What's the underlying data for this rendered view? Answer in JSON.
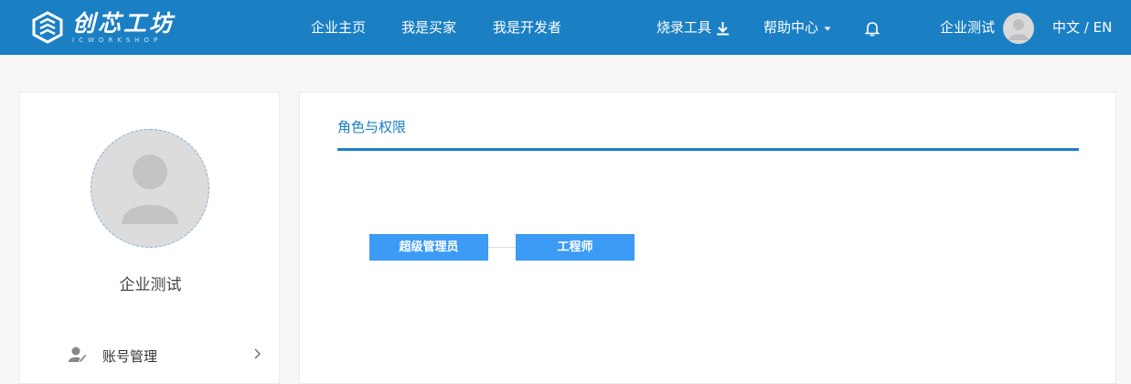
{
  "header": {
    "logo_cn": "创芯工坊",
    "logo_en": "ICWORKSHOP",
    "nav": {
      "home": "企业主页",
      "buyer": "我是买家",
      "developer": "我是开发者"
    },
    "burn_tool": "烧录工具",
    "help_center": "帮助中心",
    "user_name": "企业测试",
    "language": "中文 / EN",
    "brand_color": "#1b7fc4"
  },
  "sidebar": {
    "user_name": "企业测试",
    "menu": [
      {
        "label": "账号管理",
        "icon": "user-edit-icon"
      }
    ]
  },
  "main": {
    "tab_title": "角色与权限",
    "roles": [
      "超级管理员",
      "工程师"
    ],
    "role_color": "#3b9bf5"
  }
}
